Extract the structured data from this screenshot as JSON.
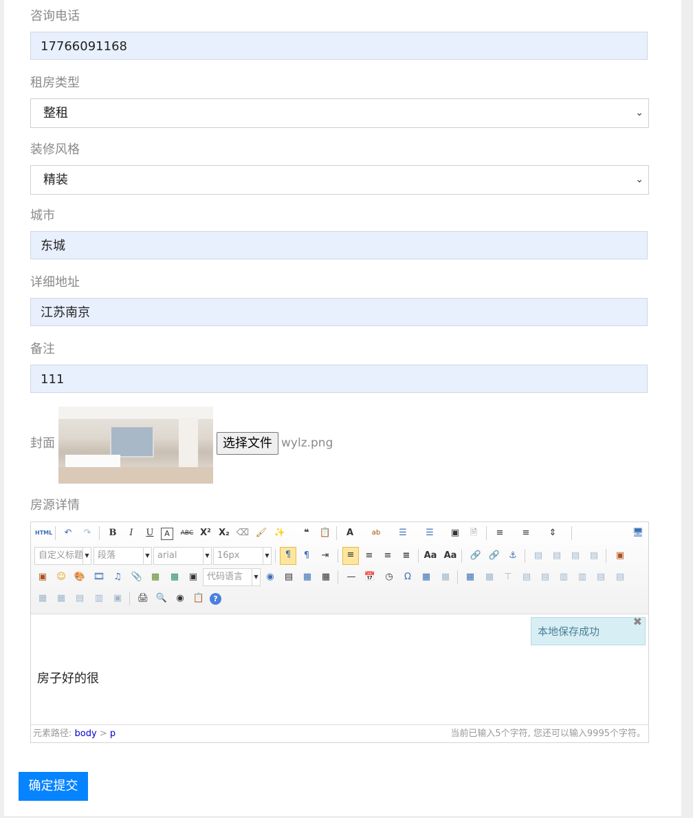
{
  "form": {
    "phone": {
      "label": "咨询电话",
      "value": "17766091168"
    },
    "rent_type": {
      "label": "租房类型",
      "value": "整租"
    },
    "decoration": {
      "label": "装修风格",
      "value": "精装"
    },
    "city": {
      "label": "城市",
      "value": "东城"
    },
    "address": {
      "label": "详细地址",
      "value": "江苏南京"
    },
    "remark": {
      "label": "备注",
      "value": "111"
    },
    "cover": {
      "label": "封面",
      "button": "选择文件",
      "filename": "wylz.png"
    },
    "details": {
      "label": "房源详情"
    }
  },
  "editor": {
    "toolbar": {
      "html_label": "HTML",
      "custom_title": "自定义标题",
      "paragraph": "段落",
      "font_family": "arial",
      "font_size": "16px",
      "code_language": "代码语言"
    },
    "save_tip": "本地保存成功",
    "content": "房子好的很",
    "status": {
      "path_label": "元素路径:",
      "path_body": "body",
      "path_sep": ">",
      "path_p": "p",
      "count": "当前已输入5个字符, 您还可以输入9995个字符。"
    }
  },
  "submit_label": "确定提交"
}
